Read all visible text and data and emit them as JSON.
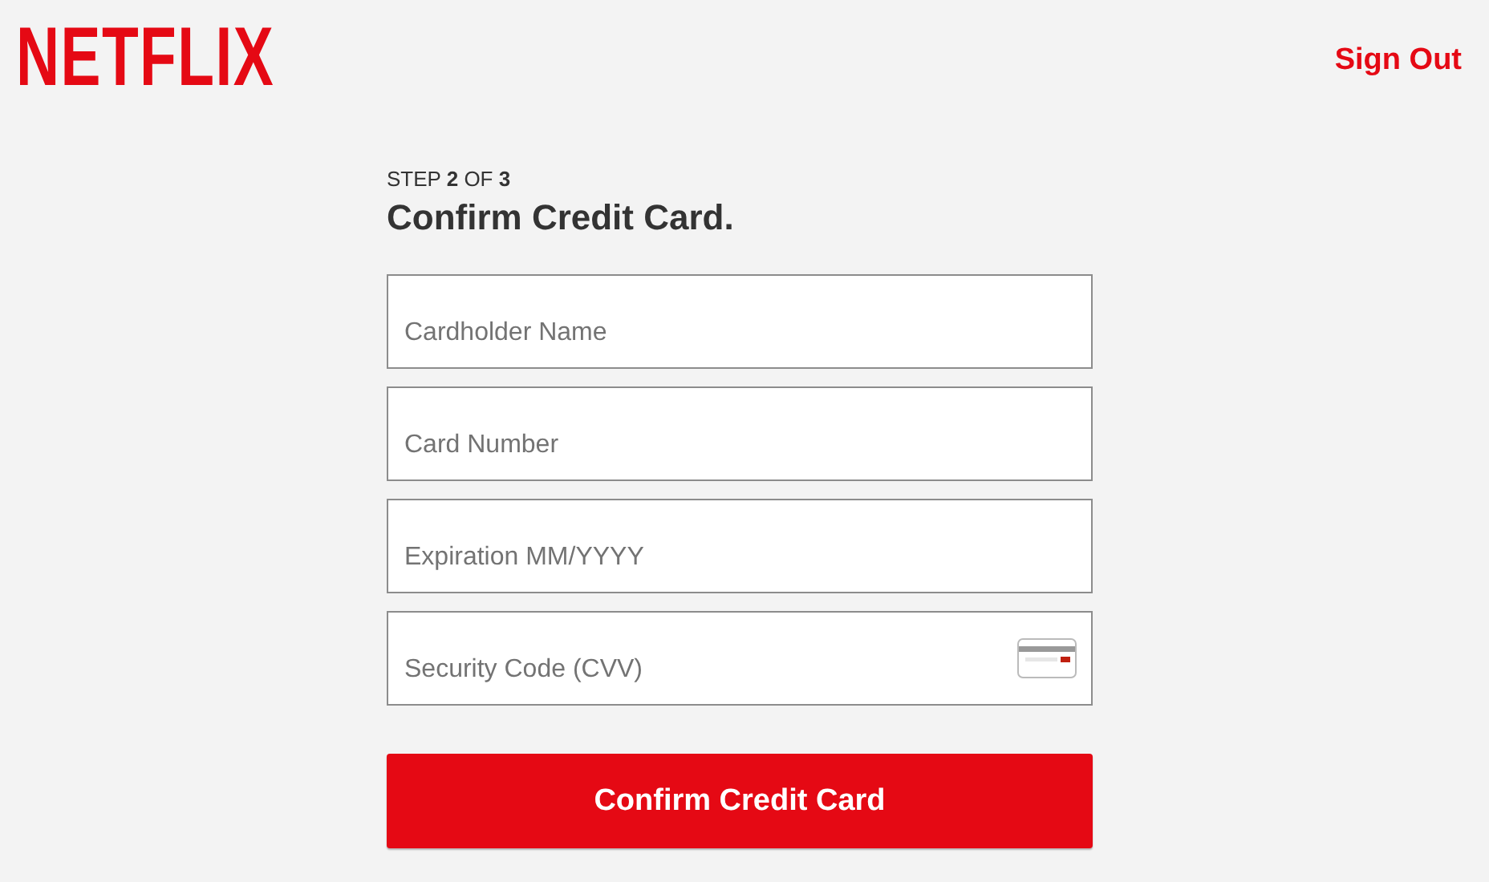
{
  "header": {
    "logo": "NETFLIX",
    "sign_out": "Sign Out"
  },
  "step": "STEP **2** OF **3**",
  "title": "Confirm Credit Card.",
  "fields": [
    {
      "kind": "text",
      "placeholder": "Cardholder Name"
    },
    {
      "kind": "text",
      "placeholder": "Card Number"
    },
    {
      "kind": "text",
      "placeholder": "Expiration MM/YYYY"
    },
    {
      "kind": "cvv",
      "placeholder": "Security Code (CVV)"
    }
  ],
  "button": "Confirm Credit Card"
}
